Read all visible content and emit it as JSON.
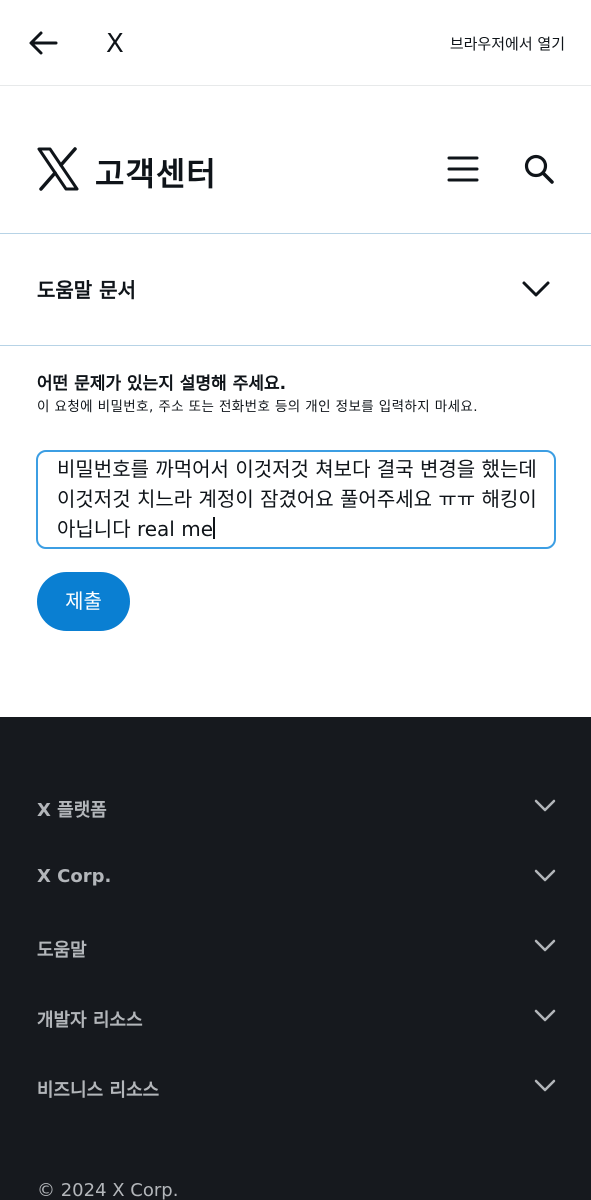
{
  "topbar": {
    "close_label": "X",
    "open_in_browser": "브라우저에서 열기"
  },
  "header": {
    "title": "고객센터"
  },
  "docs": {
    "label": "도움말 문서"
  },
  "form": {
    "question": "어떤 문제가 있는지 설명해 주세요.",
    "hint": "이 요청에 비밀번호, 주소 또는 전화번호 등의 개인 정보를 입력하지 마세요.",
    "message": "비밀번호를 까먹어서 이것저것 쳐보다 결국 변경을 했는데 이것저것 치느라 계정이 잠겼어요 풀어주세요 ㅠㅠ 해킹이 아닙니다 real me",
    "submit_label": "제출"
  },
  "footer": {
    "items": [
      {
        "label": "X 플랫폼"
      },
      {
        "label": "X Corp."
      },
      {
        "label": "도움말"
      },
      {
        "label": "개발자 리소스"
      },
      {
        "label": "비즈니스 리소스"
      }
    ],
    "copyright": "© 2024 X Corp."
  },
  "colors": {
    "accent": "#0a7fd2",
    "input_border": "#3c9ee3",
    "footer_bg": "#16191e",
    "footer_text": "#b3b6ba"
  }
}
